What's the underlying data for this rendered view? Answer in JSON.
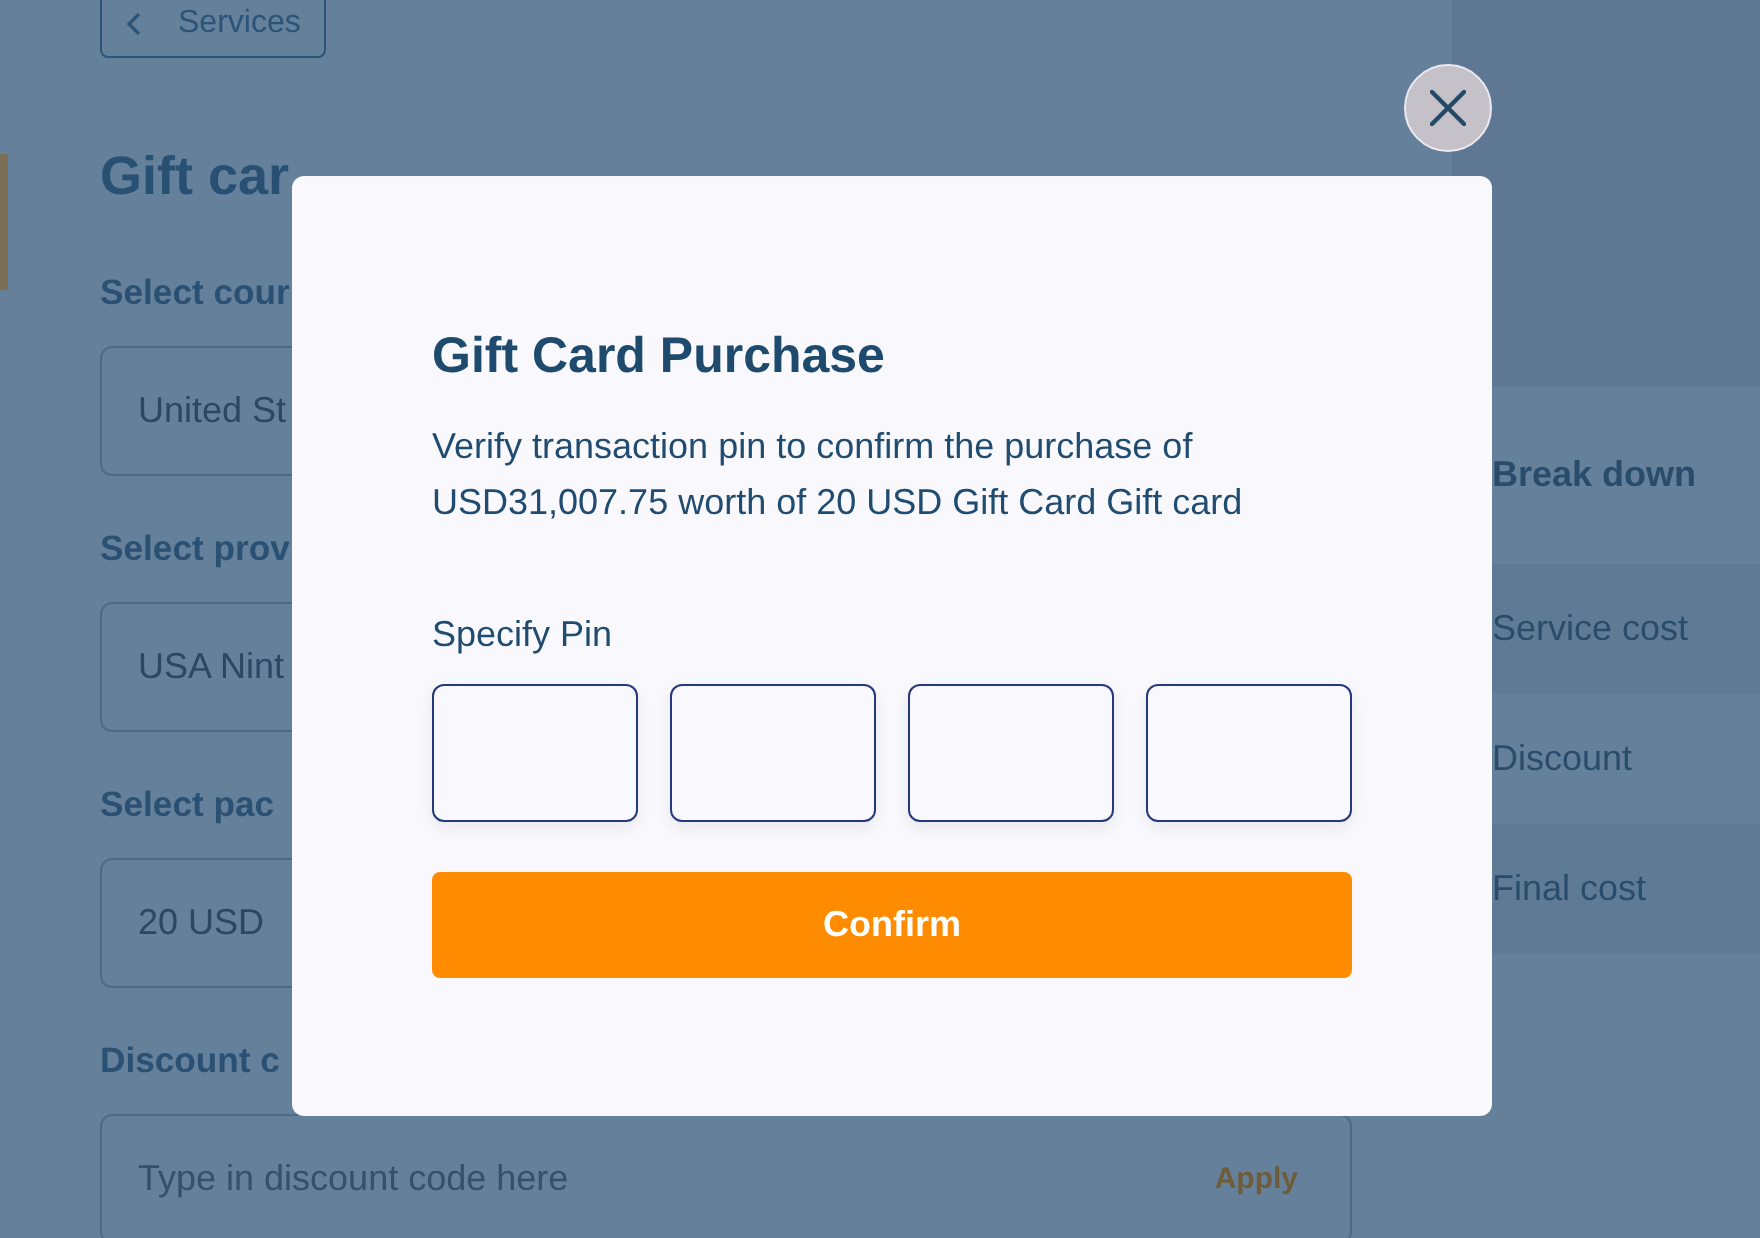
{
  "back_button": {
    "label": "Services"
  },
  "page_title": "Gift car",
  "form_fields": [
    {
      "kind": "select",
      "label": "Select cour",
      "value": "United St"
    },
    {
      "kind": "select",
      "label": "Select prov",
      "value": "USA Nint"
    },
    {
      "kind": "select",
      "label": "Select pac",
      "value": "20 USD"
    },
    {
      "kind": "input",
      "label": "Discount c",
      "placeholder": "Type in discount code here",
      "action": "Apply"
    }
  ],
  "breakdown": [
    {
      "kind": "header",
      "label": "Break down"
    },
    {
      "kind": "item",
      "label": "Service cost"
    },
    {
      "kind": "item",
      "label": "Discount"
    },
    {
      "kind": "item",
      "label": "Final cost"
    }
  ],
  "modal": {
    "title": "Gift Card Purchase",
    "message": "Verify transaction pin to confirm the purchase of USD31,007.75 worth of 20 USD Gift Card Gift card",
    "pin_label": "Specify Pin",
    "confirm_button": "Confirm"
  }
}
